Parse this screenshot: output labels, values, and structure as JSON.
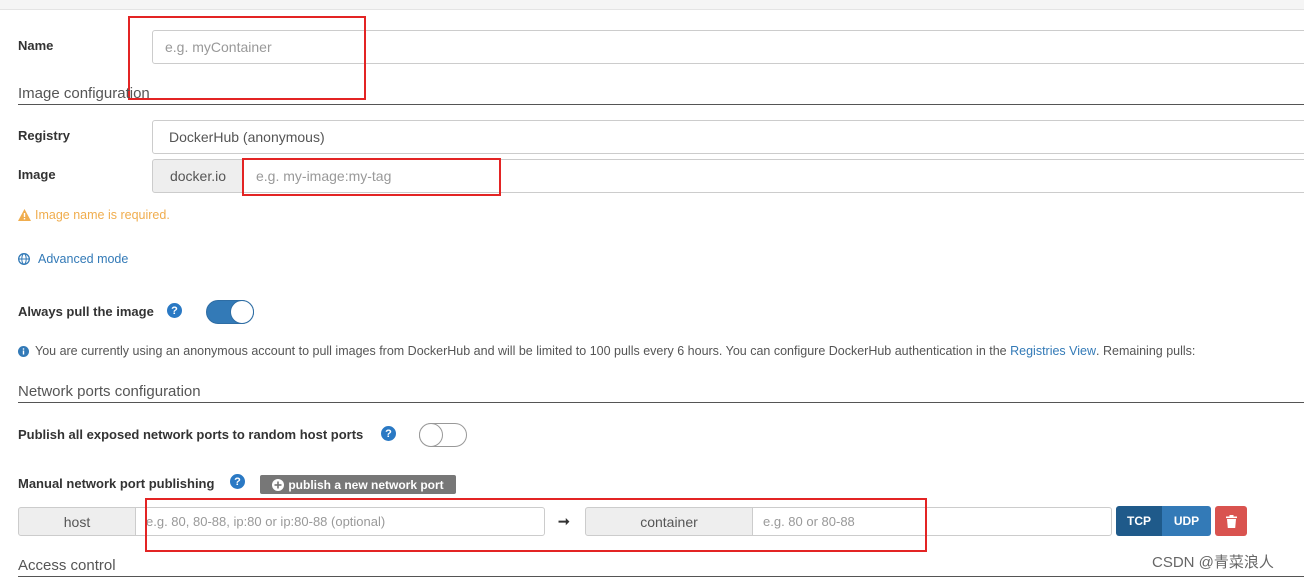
{
  "name_field": {
    "label": "Name",
    "placeholder": "e.g. myContainer"
  },
  "image_config": {
    "section_title": "Image configuration",
    "registry_label": "Registry",
    "registry_value": "DockerHub (anonymous)",
    "image_label": "Image",
    "image_prefix": "docker.io",
    "image_placeholder": "e.g. my-image:my-tag",
    "warning": "Image name is required.",
    "advanced_mode": "Advanced mode",
    "always_pull_label": "Always pull the image",
    "always_pull_on": true,
    "info_prefix": "You are currently using an anonymous account to pull images from DockerHub and will be limited to 100 pulls every 6 hours. You can configure DockerHub authentication in the",
    "info_link": "Registries View",
    "info_suffix": ". Remaining pulls:"
  },
  "network": {
    "section_title": "Network ports configuration",
    "publish_all_label": "Publish all exposed network ports to random host ports",
    "publish_all_on": false,
    "manual_label": "Manual network port publishing",
    "publish_button": "publish a new network port",
    "host_addon": "host",
    "host_placeholder": "e.g. 80, 80-88, ip:80 or ip:80-88 (optional)",
    "container_addon": "container",
    "container_placeholder": "e.g. 80 or 80-88",
    "tcp": "TCP",
    "udp": "UDP"
  },
  "access": {
    "section_title": "Access control"
  },
  "watermark": "CSDN @青菜浪人",
  "colors": {
    "accent": "#337ab7",
    "warning": "#f0ad4e",
    "danger": "#d9534f",
    "annotation_red": "#e32424"
  }
}
